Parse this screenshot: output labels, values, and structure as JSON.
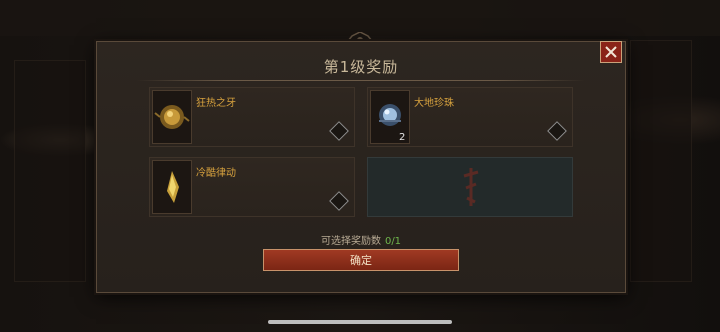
{
  "dialog": {
    "title": "第1级奖励",
    "close_label": "×",
    "items": [
      {
        "name": "狂热之牙",
        "count": "",
        "icon": "fang-orb-icon"
      },
      {
        "name": "大地珍珠",
        "count": "2",
        "icon": "earth-pearl-icon"
      },
      {
        "name": "冷酷律动",
        "count": "",
        "icon": "cold-rhythm-shard-icon"
      },
      {
        "name": "",
        "count": "",
        "icon": "locked-rune-icon"
      }
    ],
    "counter_label": "可选择奖励数",
    "counter_value": "0/1",
    "confirm_label": "确定"
  },
  "colors": {
    "accent_red": "#8a2318",
    "item_name": "#d7a23e",
    "counter_green": "#6fb64d"
  }
}
